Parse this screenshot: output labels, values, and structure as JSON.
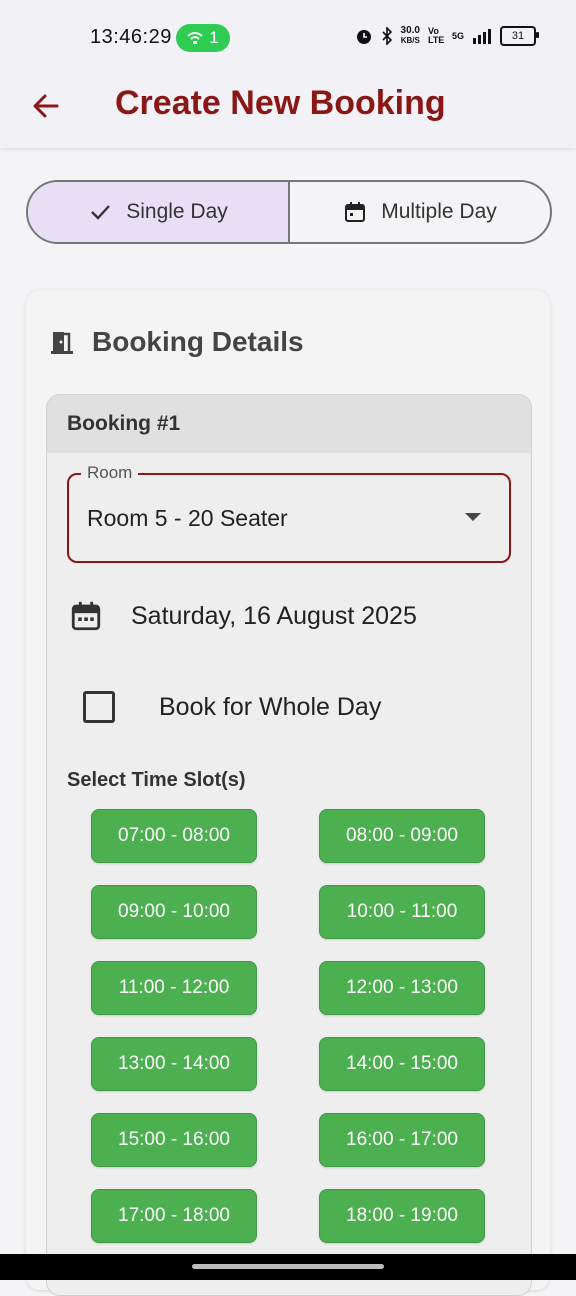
{
  "status_bar": {
    "time": "13:46:29",
    "wifi_badge": "1",
    "speed_value": "30.0",
    "speed_unit": "KB/S",
    "volte": "Vo LTE",
    "network": "5G",
    "battery": "31"
  },
  "app_bar": {
    "title": "Create New Booking",
    "back_icon": "arrow-back-icon",
    "accent_color": "#8b1616"
  },
  "mode_toggle": {
    "single_label": "Single Day",
    "multiple_label": "Multiple Day",
    "selected": "single"
  },
  "booking_details": {
    "title": "Booking Details",
    "icon": "door-icon",
    "booking": {
      "header": "Booking #1",
      "room_label": "Room",
      "room_value": "Room 5 - 20 Seater",
      "date": "Saturday, 16 August 2025",
      "whole_day_label": "Book for Whole Day",
      "whole_day_checked": false,
      "time_slot_heading": "Select Time Slot(s)",
      "slot_color": "#4caf50",
      "time_slots": [
        "07:00 - 08:00",
        "08:00 - 09:00",
        "09:00 - 10:00",
        "10:00 - 11:00",
        "11:00 - 12:00",
        "12:00 - 13:00",
        "13:00 - 14:00",
        "14:00 - 15:00",
        "15:00 - 16:00",
        "16:00 - 17:00",
        "17:00 - 18:00",
        "18:00 - 19:00"
      ]
    }
  }
}
